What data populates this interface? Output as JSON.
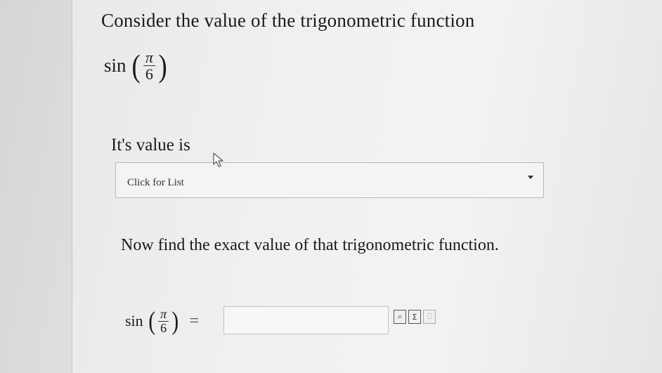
{
  "prompt": "Consider the value of the trigonometric function",
  "expression": {
    "func": "sin",
    "numerator": "π",
    "denominator": "6"
  },
  "value_label": "It's value is",
  "dropdown": {
    "selected": "Click for List"
  },
  "instruction": "Now find the exact value of that trigonometric function.",
  "answer": {
    "equals": "=",
    "value": ""
  },
  "tools": [
    {
      "name": "preview-icon",
      "glyph": "⌕"
    },
    {
      "name": "sigma-icon",
      "glyph": "Σ"
    },
    {
      "name": "help-icon",
      "glyph": "⎕"
    }
  ]
}
